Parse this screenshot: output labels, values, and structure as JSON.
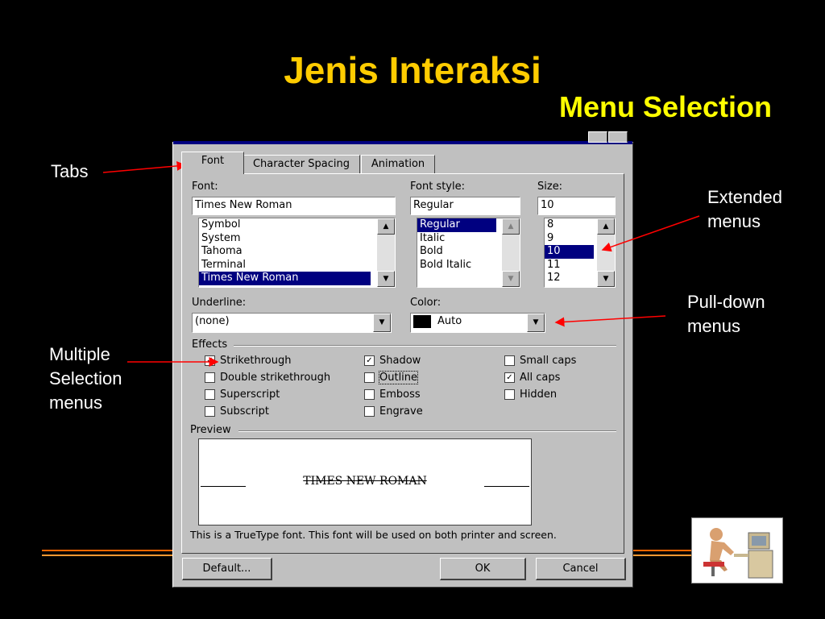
{
  "slide": {
    "title": "Jenis Interaksi",
    "subtitle": "Menu Selection"
  },
  "callouts": {
    "tabs": "Tabs",
    "extended_1": "Extended",
    "extended_2": "menus",
    "pulldown_1": "Pull-down",
    "pulldown_2": "menus",
    "multiple_1": "Multiple",
    "multiple_2": "Selection",
    "multiple_3": "menus"
  },
  "dialog": {
    "tabs": [
      "Font",
      "Character Spacing",
      "Animation"
    ],
    "active_tab": "Font",
    "font": {
      "label": "Font:",
      "value": "Times New Roman",
      "items": [
        "Symbol",
        "System",
        "Tahoma",
        "Terminal",
        "Times New Roman"
      ],
      "selected": "Times New Roman"
    },
    "font_style": {
      "label": "Font style:",
      "value": "Regular",
      "items": [
        "Regular",
        "Italic",
        "Bold",
        "Bold Italic"
      ],
      "selected": "Regular"
    },
    "size": {
      "label": "Size:",
      "value": "10",
      "items": [
        "8",
        "9",
        "10",
        "11",
        "12"
      ],
      "selected": "10"
    },
    "underline": {
      "label": "Underline:",
      "value": "(none)"
    },
    "color": {
      "label": "Color:",
      "value": "Auto",
      "swatch": "#000000"
    },
    "effects": {
      "label": "Effects",
      "options": [
        {
          "label": "Strikethrough",
          "checked": true
        },
        {
          "label": "Double strikethrough",
          "checked": false
        },
        {
          "label": "Superscript",
          "checked": false
        },
        {
          "label": "Subscript",
          "checked": false
        },
        {
          "label": "Shadow",
          "checked": true
        },
        {
          "label": "Outline",
          "checked": false
        },
        {
          "label": "Emboss",
          "checked": false
        },
        {
          "label": "Engrave",
          "checked": false
        },
        {
          "label": "Small caps",
          "checked": false
        },
        {
          "label": "All caps",
          "checked": true
        },
        {
          "label": "Hidden",
          "checked": false
        }
      ]
    },
    "preview": {
      "label": "Preview",
      "sample": "TIMES NEW ROMAN",
      "note": "This is a TrueType font. This font will be used on both printer and screen."
    },
    "buttons": {
      "default": "Default...",
      "ok": "OK",
      "cancel": "Cancel"
    }
  },
  "colors": {
    "background": "#000000",
    "title": "#ffcc00",
    "subtitle": "#ffff00",
    "arrow": "#ff0000",
    "selection": "#000080",
    "dialog_face": "#c0c0c0"
  },
  "icons": [
    "scroll-up-icon",
    "scroll-down-icon",
    "dropdown-arrow-icon",
    "checkmark-icon",
    "clipart-user-at-computer"
  ]
}
